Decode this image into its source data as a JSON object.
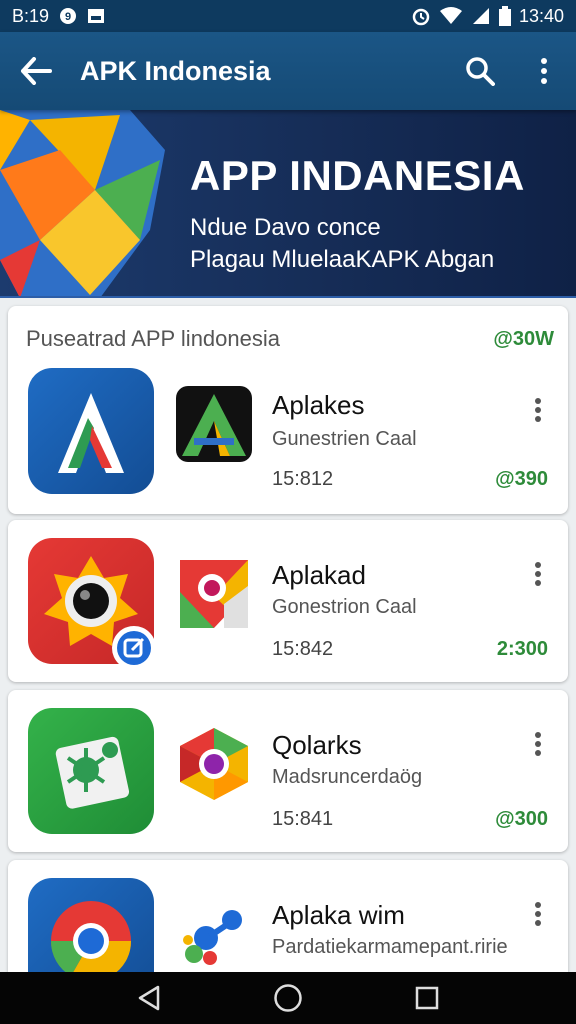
{
  "status_bar": {
    "time_left": "B:19",
    "time_right": "13:40",
    "icons": [
      "notification-icon",
      "image-icon",
      "alarm-icon",
      "wifi-icon",
      "signal-icon",
      "battery-icon"
    ]
  },
  "app_bar": {
    "title": "APK Indonesia",
    "icons": [
      "back-arrow-icon",
      "search-icon",
      "more-vert-icon"
    ]
  },
  "banner": {
    "title": "APP INDANESIA",
    "line1": "Ndue Davo conce",
    "line2": "Plagau MluelaaKAPK Abgan"
  },
  "section": {
    "heading": "Puseatrad APP lindonesia",
    "count": "@30W"
  },
  "apps": [
    {
      "name": "Aplakes",
      "developer": "Gunestrien Caal",
      "meta": "15:812",
      "rating": "@390"
    },
    {
      "name": "Aplakad",
      "developer": "Gonestrion Caal",
      "meta": "15:842",
      "rating": "2:300"
    },
    {
      "name": "Qolarks",
      "developer": "Madsruncerdaög",
      "meta": "15:841",
      "rating": "@300"
    },
    {
      "name": "Aplaka wim",
      "developer": "Pardatiekarmamepant.ririe",
      "meta": "",
      "rating": ""
    }
  ],
  "nav_bar": {
    "icons": [
      "back-triangle-icon",
      "home-circle-icon",
      "recents-square-icon"
    ]
  },
  "colors": {
    "app_bar": "#1b5686",
    "status_bar": "#0e3a5f",
    "banner": "#162d57",
    "rating_green": "#2e8b3a"
  }
}
